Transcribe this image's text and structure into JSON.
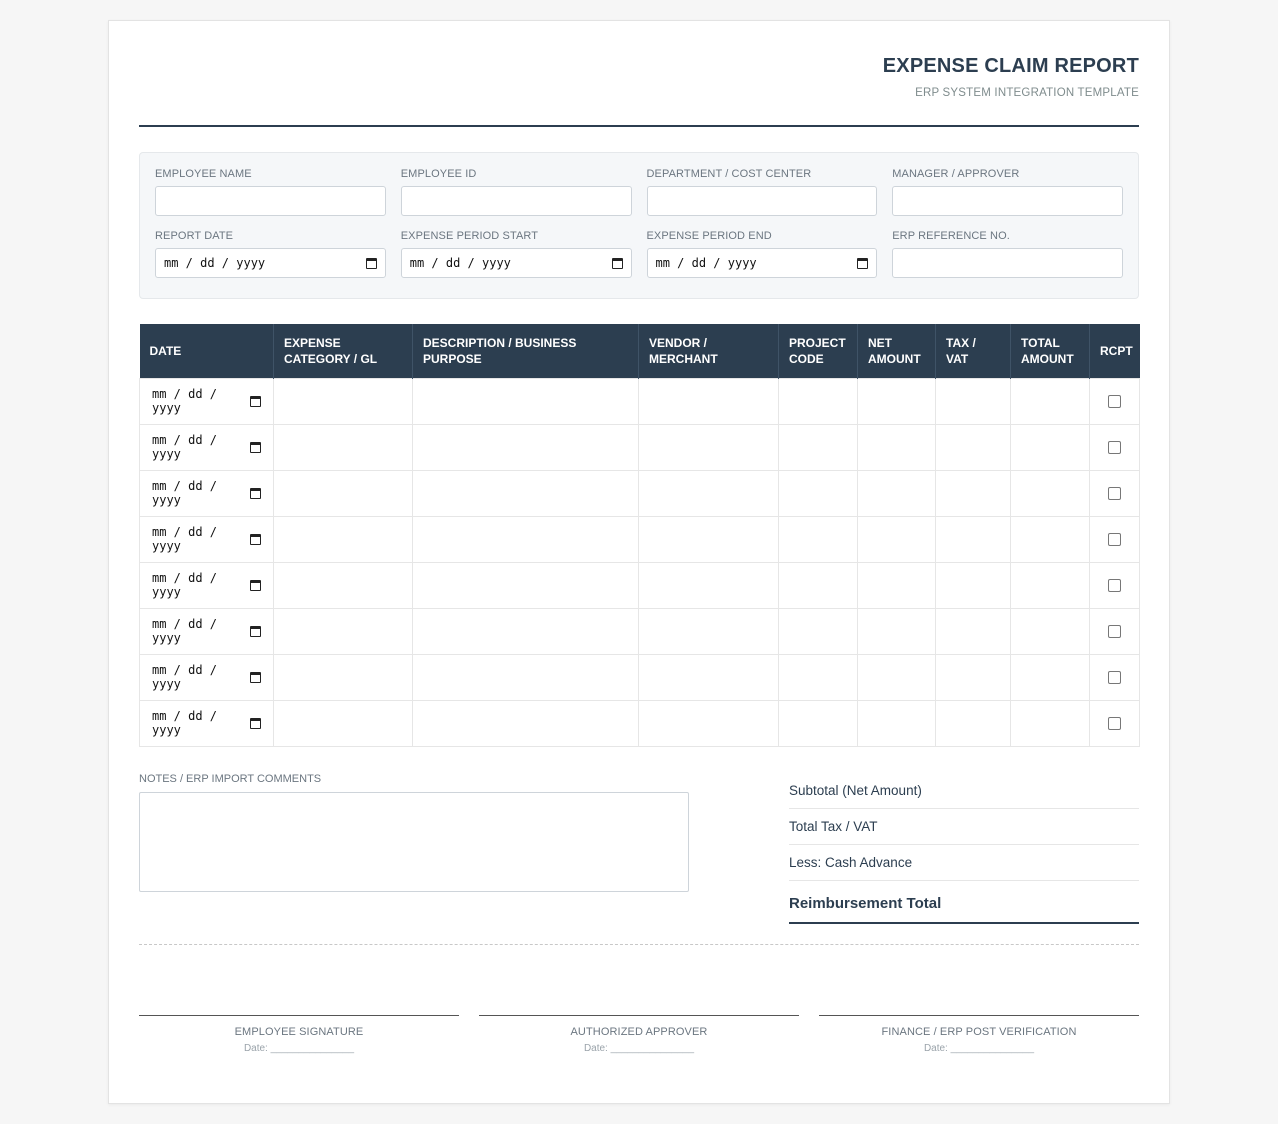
{
  "header": {
    "title": "EXPENSE CLAIM REPORT",
    "subtitle": "ERP SYSTEM INTEGRATION TEMPLATE"
  },
  "fields": [
    {
      "label": "EMPLOYEE NAME",
      "value": ""
    },
    {
      "label": "EMPLOYEE ID",
      "value": ""
    },
    {
      "label": "DEPARTMENT / COST CENTER",
      "value": ""
    },
    {
      "label": "MANAGER / APPROVER",
      "value": ""
    },
    {
      "label": "REPORT DATE",
      "value": "mm / dd / yyyy"
    },
    {
      "label": "EXPENSE PERIOD START",
      "value": "mm / dd / yyyy"
    },
    {
      "label": "EXPENSE PERIOD END",
      "value": "mm / dd / yyyy"
    },
    {
      "label": "ERP REFERENCE NO.",
      "value": ""
    }
  ],
  "table": {
    "headers": [
      "DATE",
      "EXPENSE CATEGORY / GL",
      "DESCRIPTION / BUSINESS PURPOSE",
      "VENDOR / MERCHANT",
      "PROJECT CODE",
      "NET AMOUNT",
      "TAX / VAT",
      "TOTAL AMOUNT",
      "RCPT"
    ],
    "date_placeholder": "mm / dd / yyyy"
  },
  "notes": {
    "label": "NOTES / ERP IMPORT COMMENTS"
  },
  "totals": {
    "subtotal": "Subtotal (Net Amount)",
    "tax": "Total Tax / VAT",
    "advance": "Less: Cash Advance",
    "grand": "Reimbursement Total"
  },
  "signatures": [
    {
      "title": "EMPLOYEE SIGNATURE",
      "date": "Date: _______________"
    },
    {
      "title": "AUTHORIZED APPROVER",
      "date": "Date: _______________"
    },
    {
      "title": "FINANCE / ERP POST VERIFICATION",
      "date": "Date: _______________"
    }
  ]
}
